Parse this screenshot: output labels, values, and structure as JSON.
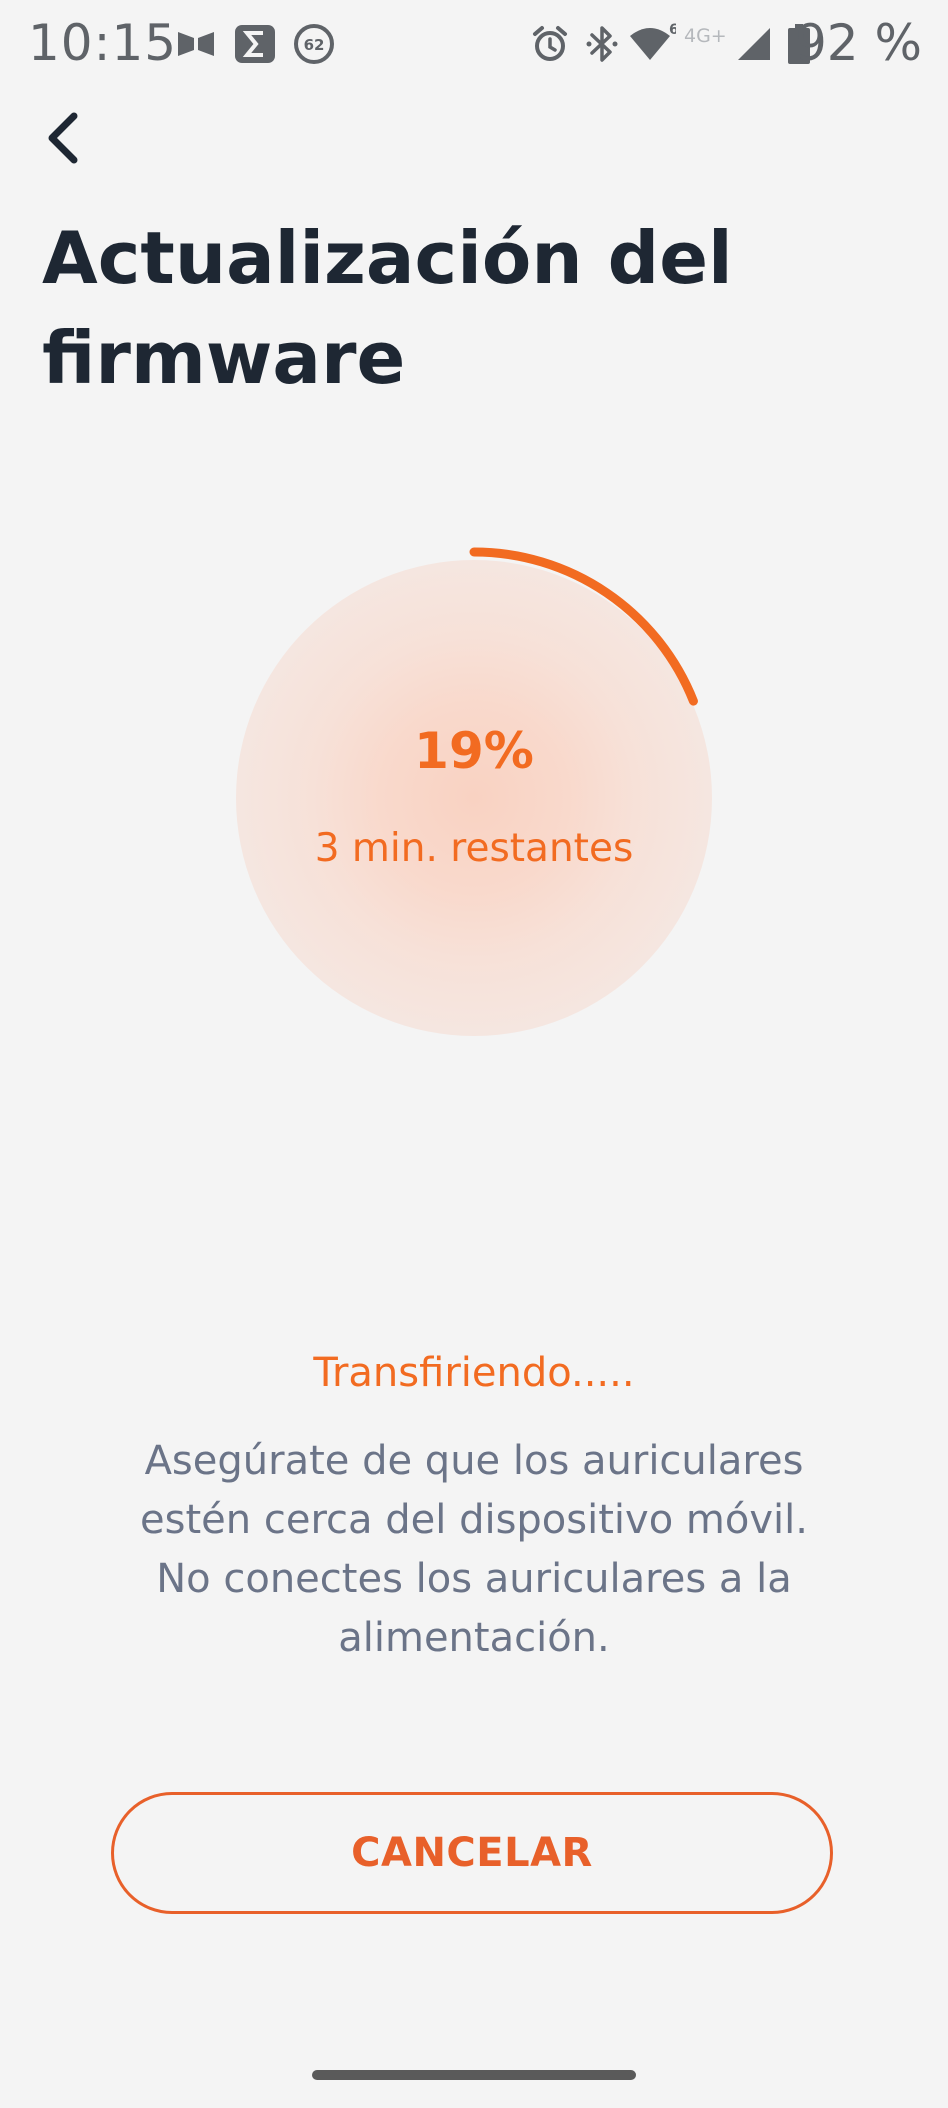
{
  "status_bar": {
    "time": "10:15",
    "notification_badge": "62",
    "network_label": "4G+",
    "wifi_level": "6",
    "battery_text": "92 %",
    "icons": [
      "media-icon",
      "sigma-icon",
      "badge-62-icon",
      "alarm-icon",
      "bluetooth-icon",
      "wifi-icon",
      "signal-icon",
      "battery-icon"
    ]
  },
  "header": {
    "back_icon": "chevron-left-icon",
    "title": "Actualización del firmware"
  },
  "progress": {
    "percent": 19,
    "percent_label": "19%",
    "remaining_label": "3 min. restantes",
    "accent_color": "#f26b21"
  },
  "status": {
    "transfer_label": "Transfiriendo.....",
    "instructions": "Asegúrate de que los auriculares estén cerca del dispositivo móvil. No conectes los auriculares a la alimentación."
  },
  "actions": {
    "cancel_label": "CANCELAR"
  }
}
